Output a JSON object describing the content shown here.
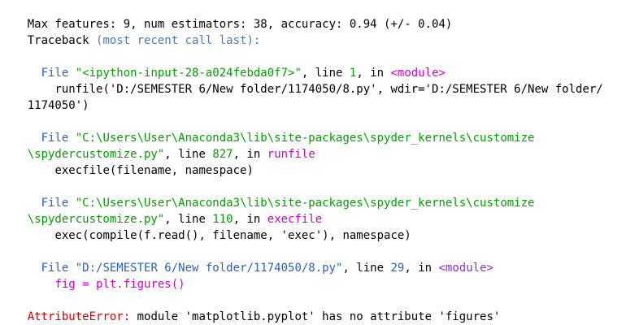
{
  "console": {
    "line_01": "Max features: 9, num estimators: 38, accuracy: 0.94 (+/- 0.04)",
    "traceback_label": "Traceback",
    "traceback_note": "(most recent call last):",
    "frame1": {
      "file_prefix": "File",
      "file_path": "\"<ipython-input-28-a024febda0f7>\"",
      "file_sep": ", line ",
      "line_no": "1",
      "in_label": ", in ",
      "func": "<module>",
      "code_1": "runfile('D:/SEMESTER 6/New folder/1174050/8.py', wdir='D:/SEMESTER 6/New folder/",
      "code_2": "1174050')"
    },
    "frame2": {
      "file_prefix": "File",
      "file_path_1": "\"C:\\Users\\User\\Anaconda3\\lib\\site-packages\\spyder_kernels\\customize",
      "file_path_2": "\\spydercustomize.py\"",
      "file_sep": ", line ",
      "line_no": "827",
      "in_label": ", in ",
      "func": "runfile",
      "code": "execfile(filename, namespace)"
    },
    "frame3": {
      "file_prefix": "File",
      "file_path_1": "\"C:\\Users\\User\\Anaconda3\\lib\\site-packages\\spyder_kernels\\customize",
      "file_path_2": "\\spydercustomize.py\"",
      "file_sep": ", line ",
      "line_no": "110",
      "in_label": ", in ",
      "func": "execfile",
      "code": "exec(compile(f.read(), filename, 'exec'), namespace)"
    },
    "frame4": {
      "file_prefix": "File",
      "file_path": "\"D:/SEMESTER 6/New folder/1174050/8.py\"",
      "file_sep": ", line ",
      "line_no": "29",
      "in_label": ", in ",
      "func": "<module>",
      "code": "fig = plt.figures()"
    },
    "error_type": "AttributeError:",
    "error_message": " module 'matplotlib.pyplot' has no attribute 'figures'"
  },
  "colors": {
    "background": "#ffffff",
    "text": "#000000",
    "green_path": "#00a000",
    "blue_path": "#2b62b3",
    "magenta_func": "#d000d0",
    "purple_module": "#8a2be2",
    "error_red": "#d00000"
  }
}
